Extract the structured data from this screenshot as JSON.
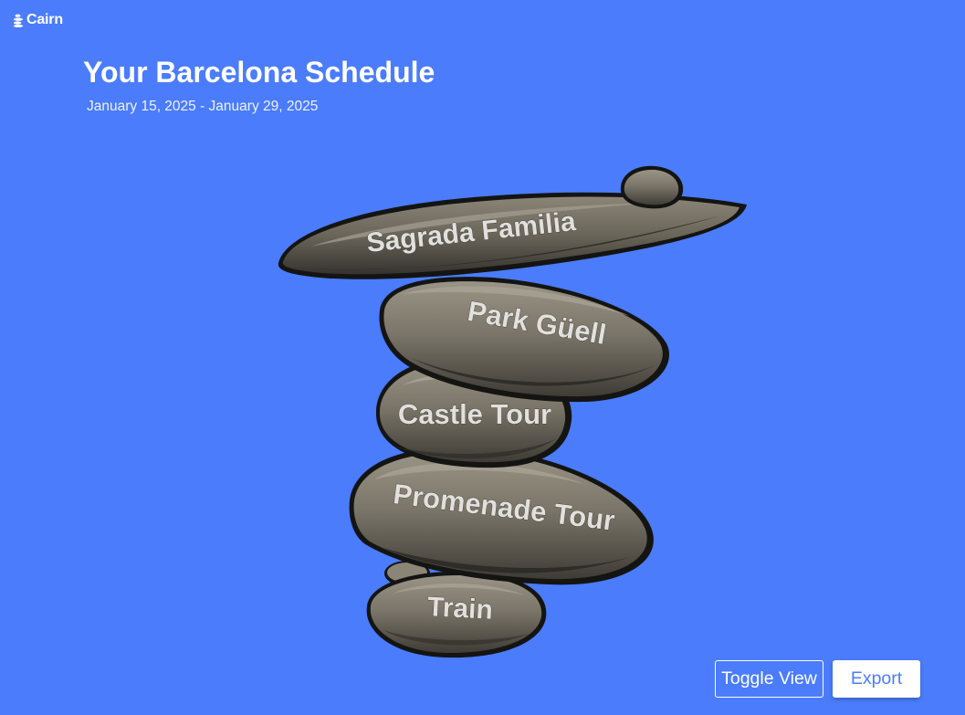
{
  "app": {
    "name": "Cairn",
    "logo_icon": "cairn-stack-icon"
  },
  "header": {
    "title": "Your Barcelona Schedule",
    "date_range": "January 15, 2025 - January 29, 2025"
  },
  "stones": [
    {
      "label": "Sagrada Familia"
    },
    {
      "label": "Park Güell"
    },
    {
      "label": "Castle Tour"
    },
    {
      "label": "Promenade Tour"
    },
    {
      "label": "Train"
    }
  ],
  "actions": {
    "toggle_view_label": "Toggle View",
    "export_label": "Export"
  },
  "colors": {
    "background": "#4a7cfc",
    "stone_light": "#8e887b",
    "stone_mid": "#6f6a5f",
    "stone_dark": "#3f3c36",
    "outline": "#141412",
    "label_text": "#e2e0dc"
  }
}
